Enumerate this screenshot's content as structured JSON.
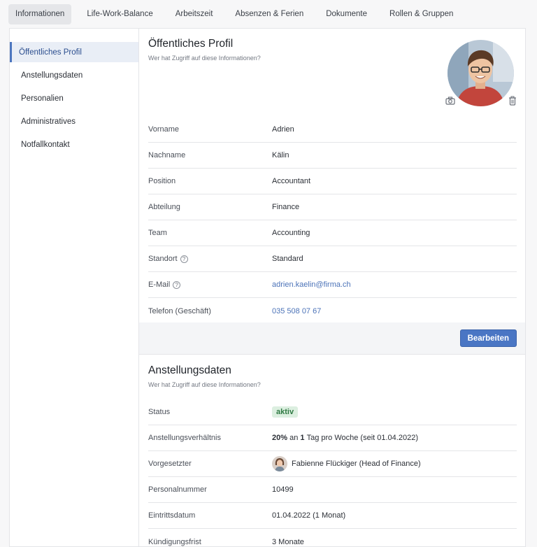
{
  "tabs": [
    "Informationen",
    "Life-Work-Balance",
    "Arbeitszeit",
    "Absenzen & Ferien",
    "Dokumente",
    "Rollen & Gruppen"
  ],
  "sidebar": {
    "items": [
      "Öffentliches Profil",
      "Anstellungsdaten",
      "Personalien",
      "Administratives",
      "Notfallkontakt"
    ]
  },
  "profile": {
    "title": "Öffentliches Profil",
    "subtitle": "Wer hat Zugriff auf diese Informationen?",
    "fields": [
      {
        "label": "Vorname",
        "value": "Adrien"
      },
      {
        "label": "Nachname",
        "value": "Kälin"
      },
      {
        "label": "Position",
        "value": "Accountant"
      },
      {
        "label": "Abteilung",
        "value": "Finance"
      },
      {
        "label": "Team",
        "value": "Accounting"
      },
      {
        "label": "Standort",
        "value": "Standard"
      },
      {
        "label": "E-Mail",
        "value": "adrien.kaelin@firma.ch"
      },
      {
        "label": "Telefon (Geschäft)",
        "value": "035 508 07 67"
      }
    ],
    "edit_label": "Bearbeiten",
    "help_glyph": "?"
  },
  "employment": {
    "title": "Anstellungsdaten",
    "subtitle": "Wer hat Zugriff auf diese Informationen?",
    "status_label": "Status",
    "status_value": "aktiv",
    "relation_label": "Anstellungsverhältnis",
    "relation_percent": "20%",
    "relation_mid": "an",
    "relation_days": "1",
    "relation_rest": "Tag pro Woche (seit 01.04.2022)",
    "manager_label": "Vorgesetzter",
    "manager_value": "Fabienne Flückiger (Head of Finance)",
    "staffno_label": "Personalnummer",
    "staffno_value": "10499",
    "entry_label": "Eintrittsdatum",
    "entry_value": "01.04.2022 (1 Monat)",
    "notice_label": "Kündigungsfrist",
    "notice_value": "3 Monate"
  },
  "colors": {
    "accent": "#4a76c4",
    "link": "#4c73b8",
    "badge_bg": "#dcefe0",
    "badge_text": "#2f7a43"
  }
}
